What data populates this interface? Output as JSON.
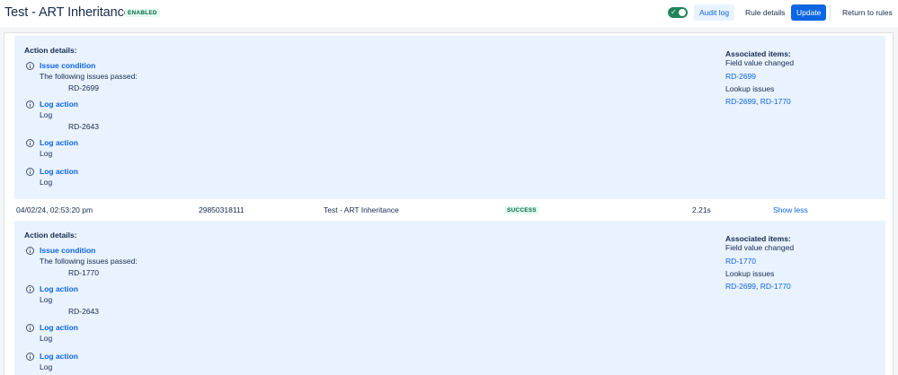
{
  "header": {
    "title": "Test - ART Inheritance",
    "status": "ENABLED",
    "toggle_check": "✓",
    "audit_log": "Audit log",
    "rule_details": "Rule details",
    "update": "Update",
    "return_to_rules": "Return to rules"
  },
  "colors": {
    "primary": "#0c66e4",
    "success_text": "#006644",
    "success_bg": "#e3fcef",
    "details_bg": "#e9f2ff",
    "toggle_on": "#1f845a"
  },
  "icons": {
    "action_icon": "info-circle-icon",
    "toggle_icon": "check-icon"
  },
  "entries": [
    {
      "details_title": "Action details:",
      "actions": [
        {
          "name": "Issue condition",
          "sub": "The following issues passed:",
          "issue": "RD-2699"
        },
        {
          "name": "Log action",
          "sub": "Log",
          "issue": "RD-2643"
        },
        {
          "name": "Log action",
          "sub": "Log",
          "issue": ""
        },
        {
          "name": "Log action",
          "sub": "Log",
          "issue": ""
        }
      ],
      "associated": {
        "title": "Associated items:",
        "field_value_changed": "Field value changed",
        "field_links": [
          "RD-2699"
        ],
        "lookup_issues": "Lookup issues",
        "lookup_links": [
          "RD-2699",
          "RD-1770"
        ],
        "separator": ", "
      }
    },
    {
      "details_title": "Action details:",
      "actions": [
        {
          "name": "Issue condition",
          "sub": "The following issues passed:",
          "issue": "RD-1770"
        },
        {
          "name": "Log action",
          "sub": "Log",
          "issue": "RD-2643"
        },
        {
          "name": "Log action",
          "sub": "Log",
          "issue": ""
        },
        {
          "name": "Log action",
          "sub": "Log",
          "issue": ""
        }
      ],
      "associated": {
        "title": "Associated items:",
        "field_value_changed": "Field value changed",
        "field_links": [
          "RD-1770"
        ],
        "lookup_issues": "Lookup issues",
        "lookup_links": [
          "RD-2699",
          "RD-1770"
        ],
        "separator": ", "
      }
    }
  ],
  "log_row": {
    "date": "04/02/24, 02:53:20 pm",
    "id": "29850318111",
    "rule": "Test - ART Inheritance",
    "status": "SUCCESS",
    "duration": "2.21s",
    "show_less": "Show less"
  }
}
